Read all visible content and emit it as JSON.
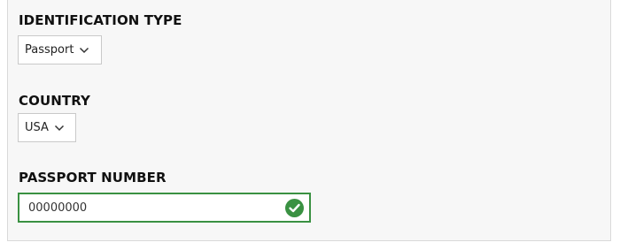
{
  "form": {
    "id_type": {
      "label": "IDENTIFICATION TYPE",
      "selected": "Passport",
      "icon": "chevron-down-icon"
    },
    "country": {
      "label": "COUNTRY",
      "selected": "USA",
      "icon": "chevron-down-icon"
    },
    "passport_number": {
      "label": "PASSPORT NUMBER",
      "value": "00000000",
      "status_icon": "check-circle-icon",
      "valid_color": "#3a9142"
    }
  }
}
